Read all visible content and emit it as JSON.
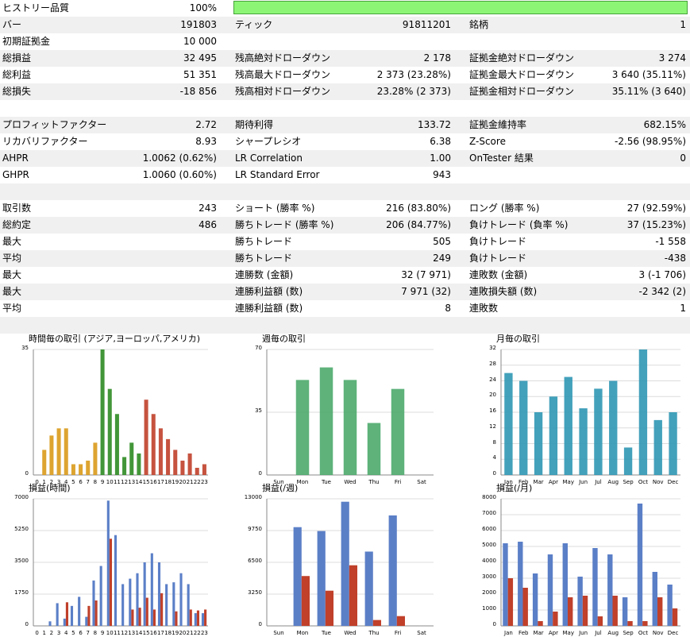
{
  "quality": {
    "label": "ヒストリー品質",
    "value": "100%",
    "fraction": 1.0
  },
  "rows": [
    {
      "shade": true,
      "c": [
        [
          "バー",
          "191803"
        ],
        [
          "ティック",
          "91811201"
        ],
        [
          "銘柄",
          "1"
        ]
      ]
    },
    {
      "shade": false,
      "c": [
        [
          "初期証拠金",
          "10 000"
        ],
        [
          "",
          ""
        ],
        [
          "",
          ""
        ]
      ]
    },
    {
      "shade": true,
      "c": [
        [
          "総損益",
          "32 495"
        ],
        [
          "残高絶対ドローダウン",
          "2 178"
        ],
        [
          "証拠金絶対ドローダウン",
          "3 274"
        ]
      ]
    },
    {
      "shade": false,
      "c": [
        [
          "総利益",
          "51 351"
        ],
        [
          "残高最大ドローダウン",
          "2 373 (23.28%)"
        ],
        [
          "証拠金最大ドローダウン",
          "3 640 (35.11%)"
        ]
      ]
    },
    {
      "shade": true,
      "c": [
        [
          "総損失",
          "-18 856"
        ],
        [
          "残高相対ドローダウン",
          "23.28% (2 373)"
        ],
        [
          "証拠金相対ドローダウン",
          "35.11% (3 640)"
        ]
      ]
    },
    {
      "shade": false,
      "c": [
        [
          "",
          ""
        ],
        [
          "",
          ""
        ],
        [
          "",
          ""
        ]
      ]
    },
    {
      "shade": true,
      "c": [
        [
          "プロフィットファクター",
          "2.72"
        ],
        [
          "期待利得",
          "133.72"
        ],
        [
          "証拠金維持率",
          "682.15%"
        ]
      ]
    },
    {
      "shade": false,
      "c": [
        [
          "リカバリファクター",
          "8.93"
        ],
        [
          "シャープレシオ",
          "6.38"
        ],
        [
          "Z-Score",
          "-2.56 (98.95%)"
        ]
      ]
    },
    {
      "shade": true,
      "c": [
        [
          "AHPR",
          "1.0062 (0.62%)"
        ],
        [
          "LR Correlation",
          "1.00"
        ],
        [
          "OnTester 結果",
          "0"
        ]
      ]
    },
    {
      "shade": false,
      "c": [
        [
          "GHPR",
          "1.0060 (0.60%)"
        ],
        [
          "LR Standard Error",
          "943"
        ],
        [
          "",
          ""
        ]
      ]
    },
    {
      "shade": true,
      "c": [
        [
          "",
          ""
        ],
        [
          "",
          ""
        ],
        [
          "",
          ""
        ]
      ]
    },
    {
      "shade": false,
      "c": [
        [
          "取引数",
          "243"
        ],
        [
          "ショート (勝率 %)",
          "216 (83.80%)"
        ],
        [
          "ロング (勝率 %)",
          "27 (92.59%)"
        ]
      ]
    },
    {
      "shade": true,
      "c": [
        [
          "総約定",
          "486"
        ],
        [
          "勝ちトレード (勝率 %)",
          "206 (84.77%)"
        ],
        [
          "負けトレード (負率 %)",
          "37 (15.23%)"
        ]
      ]
    },
    {
      "shade": false,
      "c": [
        [
          "最大",
          ""
        ],
        [
          "勝ちトレード",
          "505"
        ],
        [
          "負けトレード",
          "-1 558"
        ]
      ]
    },
    {
      "shade": true,
      "c": [
        [
          "平均",
          ""
        ],
        [
          "勝ちトレード",
          "249"
        ],
        [
          "負けトレード",
          "-438"
        ]
      ]
    },
    {
      "shade": false,
      "c": [
        [
          "最大",
          ""
        ],
        [
          "連勝数 (金額)",
          "32 (7 971)"
        ],
        [
          "連敗数 (金額)",
          "3 (-1 706)"
        ]
      ]
    },
    {
      "shade": true,
      "c": [
        [
          "最大",
          ""
        ],
        [
          "連勝利益額 (数)",
          "7 971 (32)"
        ],
        [
          "連敗損失額 (数)",
          "-2 342 (2)"
        ]
      ]
    },
    {
      "shade": false,
      "c": [
        [
          "平均",
          ""
        ],
        [
          "連勝利益額 (数)",
          "8"
        ],
        [
          "連敗数",
          "1"
        ]
      ]
    },
    {
      "shade": true,
      "c": [
        [
          "",
          ""
        ],
        [
          "",
          ""
        ],
        [
          "",
          ""
        ]
      ]
    }
  ],
  "colors": {
    "asia": "#d99a1a",
    "europe": "#2e8b22",
    "america": "#c0402a",
    "profit": "#5b7fc7",
    "loss": "#c0402a",
    "weekly": "#4daa6c",
    "monthly": "#2f97b4",
    "grid": "#dcdcdc",
    "quality_bar": "#8cf576"
  },
  "chart_data": [
    {
      "type": "bar",
      "title": "時間毎の取引 (アジア,ヨーロッパ,アメリカ)",
      "categories": [
        "0",
        "1",
        "2",
        "3",
        "4",
        "5",
        "6",
        "7",
        "8",
        "9",
        "10",
        "11",
        "12",
        "13",
        "14",
        "15",
        "16",
        "17",
        "18",
        "19",
        "20",
        "21",
        "22",
        "23"
      ],
      "values": [
        0,
        7,
        11,
        13,
        13,
        3,
        3,
        4,
        9,
        35,
        24,
        17,
        5,
        9,
        6,
        21,
        17,
        13,
        10,
        7,
        4,
        6,
        2,
        3
      ],
      "ylim": [
        0,
        35
      ],
      "yticks": [
        "0",
        "35"
      ],
      "segments": [
        {
          "from": 0,
          "to": 8,
          "color": "asia"
        },
        {
          "from": 9,
          "to": 14,
          "color": "europe"
        },
        {
          "from": 15,
          "to": 23,
          "color": "america"
        }
      ]
    },
    {
      "type": "bar",
      "title": "週毎の取引",
      "categories": [
        "Sun",
        "Mon",
        "Tue",
        "Wed",
        "Thu",
        "Fri",
        "Sat"
      ],
      "values": [
        0,
        53,
        60,
        53,
        29,
        48,
        0
      ],
      "ylim": [
        0,
        70
      ],
      "yticks": [
        "0",
        "35",
        "70"
      ]
    },
    {
      "type": "bar",
      "title": "月毎の取引",
      "categories": [
        "Jan",
        "Feb",
        "Mar",
        "Apr",
        "May",
        "Jun",
        "Jul",
        "Aug",
        "Sep",
        "Oct",
        "Nov",
        "Dec"
      ],
      "values": [
        26,
        24,
        16,
        20,
        25,
        17,
        22,
        24,
        7,
        32,
        14,
        16
      ],
      "ylim": [
        0,
        32
      ],
      "yticks": [
        "0",
        "4",
        "8",
        "12",
        "16",
        "20",
        "24",
        "28",
        "32"
      ]
    },
    {
      "type": "bar",
      "title": "損益(時間)",
      "categories": [
        "0",
        "1",
        "2",
        "3",
        "4",
        "5",
        "6",
        "7",
        "8",
        "9",
        "10",
        "11",
        "12",
        "13",
        "14",
        "15",
        "16",
        "17",
        "18",
        "19",
        "20",
        "21",
        "22",
        "23"
      ],
      "ylim": [
        0,
        7000
      ],
      "yticks": [
        "0",
        "1750",
        "3500",
        "5250",
        "7000"
      ],
      "series": [
        {
          "name": "profit",
          "values": [
            0,
            0,
            250,
            1250,
            400,
            1100,
            1600,
            500,
            2500,
            3300,
            6900,
            5000,
            2300,
            2600,
            2900,
            3500,
            4000,
            3500,
            2300,
            2400,
            2900,
            2300,
            700,
            700
          ]
        },
        {
          "name": "loss",
          "values": [
            0,
            0,
            0,
            0,
            1300,
            0,
            0,
            1100,
            1400,
            0,
            4800,
            0,
            0,
            900,
            1000,
            1550,
            900,
            1800,
            0,
            800,
            0,
            900,
            850,
            900
          ]
        }
      ]
    },
    {
      "type": "bar",
      "title": "損益(/週)",
      "categories": [
        "Sun",
        "Mon",
        "Tue",
        "Wed",
        "Thu",
        "Fri",
        "Sat"
      ],
      "ylim": [
        0,
        13000
      ],
      "yticks": [
        "0",
        "3250",
        "6500",
        "9750",
        "13000"
      ],
      "series": [
        {
          "name": "profit",
          "values": [
            0,
            10100,
            9700,
            12700,
            7600,
            11300,
            0
          ]
        },
        {
          "name": "loss",
          "values": [
            0,
            5100,
            3600,
            6200,
            600,
            1000,
            0
          ]
        }
      ]
    },
    {
      "type": "bar",
      "title": "損益(/月)",
      "categories": [
        "Jan",
        "Feb",
        "Mar",
        "Apr",
        "May",
        "Jun",
        "Jul",
        "Aug",
        "Sep",
        "Oct",
        "Nov",
        "Dec"
      ],
      "ylim": [
        0,
        8000
      ],
      "yticks": [
        "0",
        "1000",
        "2000",
        "3000",
        "4000",
        "5000",
        "6000",
        "7000",
        "8000"
      ],
      "series": [
        {
          "name": "profit",
          "values": [
            5200,
            5300,
            3300,
            4500,
            5200,
            3100,
            4900,
            4500,
            1800,
            7700,
            3400,
            2600
          ]
        },
        {
          "name": "loss",
          "values": [
            3000,
            2400,
            300,
            900,
            1800,
            1900,
            600,
            1900,
            300,
            300,
            1800,
            1100
          ]
        }
      ]
    }
  ]
}
